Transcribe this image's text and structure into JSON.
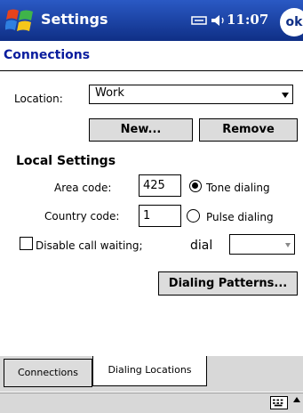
{
  "titlebar": {
    "app_title": "Settings",
    "clock": "11:07",
    "ok_label": "ok",
    "icons": [
      "windows-start-icon",
      "connectivity-icon",
      "volume-icon"
    ]
  },
  "section": {
    "title": "Connections"
  },
  "location": {
    "label": "Location:",
    "value": "Work",
    "new_label": "New...",
    "remove_label": "Remove"
  },
  "local": {
    "title": "Local Settings",
    "area_label": "Area code:",
    "area_value": "425",
    "country_label": "Country code:",
    "country_value": "1",
    "tone_label": "Tone dialing",
    "pulse_label": "Pulse dialing",
    "tone_selected": true,
    "call_waiting_label": "Disable call waiting;",
    "call_waiting_checked": false,
    "dial_label": "dial",
    "dial_value": "",
    "patterns_label": "Dialing Patterns..."
  },
  "tabs": [
    {
      "label": "Connections",
      "active": false
    },
    {
      "label": "Dialing Locations",
      "active": true
    }
  ],
  "colors": {
    "titlebar": "#133a96",
    "section_title": "#0a1d9e"
  }
}
